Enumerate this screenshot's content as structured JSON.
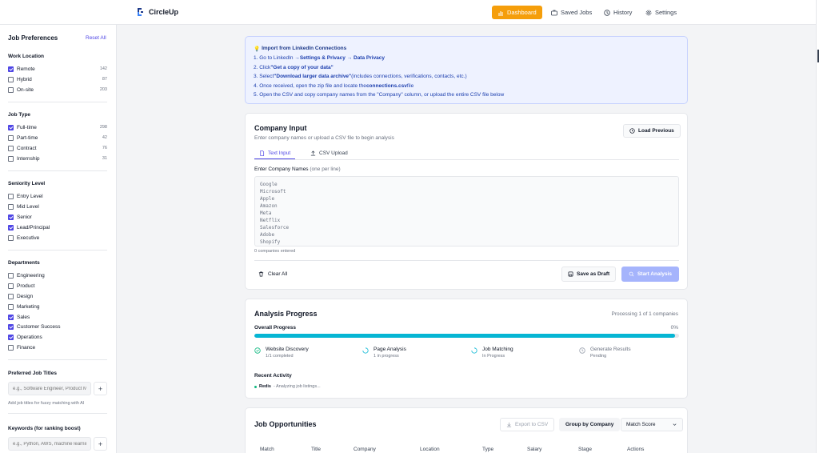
{
  "app": {
    "brand": "CircleUp",
    "nav": [
      {
        "label": "Dashboard",
        "icon": "bar-chart-icon",
        "active": true
      },
      {
        "label": "Saved Jobs",
        "icon": "briefcase-icon",
        "active": false
      },
      {
        "label": "History",
        "icon": "clock-icon",
        "active": false
      },
      {
        "label": "Settings",
        "icon": "gear-icon",
        "active": false
      }
    ]
  },
  "sidebar": {
    "title": "Job Preferences",
    "reset": "Reset All",
    "work_location": {
      "title": "Work Location",
      "items": [
        {
          "label": "Remote",
          "checked": true,
          "count": "142"
        },
        {
          "label": "Hybrid",
          "checked": false,
          "count": "87"
        },
        {
          "label": "On-site",
          "checked": false,
          "count": "203"
        }
      ]
    },
    "job_type": {
      "title": "Job Type",
      "items": [
        {
          "label": "Full-time",
          "checked": true,
          "count": "298"
        },
        {
          "label": "Part-time",
          "checked": false,
          "count": "42"
        },
        {
          "label": "Contract",
          "checked": false,
          "count": "76"
        },
        {
          "label": "Internship",
          "checked": false,
          "count": "31"
        }
      ]
    },
    "seniority": {
      "title": "Seniority Level",
      "items": [
        {
          "label": "Entry Level",
          "checked": false
        },
        {
          "label": "Mid Level",
          "checked": false
        },
        {
          "label": "Senior",
          "checked": true
        },
        {
          "label": "Lead/Principal",
          "checked": true
        },
        {
          "label": "Executive",
          "checked": false
        }
      ]
    },
    "departments": {
      "title": "Departments",
      "items": [
        {
          "label": "Engineering",
          "checked": false
        },
        {
          "label": "Product",
          "checked": false
        },
        {
          "label": "Design",
          "checked": false
        },
        {
          "label": "Marketing",
          "checked": false
        },
        {
          "label": "Sales",
          "checked": true
        },
        {
          "label": "Customer Success",
          "checked": true
        },
        {
          "label": "Operations",
          "checked": true
        },
        {
          "label": "Finance",
          "checked": false
        }
      ]
    },
    "titles": {
      "title": "Preferred Job Titles",
      "placeholder": "e.g., Software Engineer, Product Manager",
      "add": "+",
      "help": "Add job titles for fuzzy matching with AI"
    },
    "keywords": {
      "title": "Keywords (for ranking boost)",
      "placeholder": "e.g., Python, AWS, machine learning",
      "add": "+"
    }
  },
  "import": {
    "title": "Import from LinkedIn Connections",
    "steps": [
      [
        "1. Go to LinkedIn → ",
        "Settings & Privacy → Data Privacy",
        ""
      ],
      [
        "2. Click ",
        "\"Get a copy of your data\"",
        ""
      ],
      [
        "3. Select ",
        "\"Download larger data archive\"",
        " (includes connections, verifications, contacts, etc.)"
      ],
      [
        "4. Once received, open the zip file and locate the ",
        "connections.csv",
        " file"
      ],
      [
        "5. Open the CSV and copy company names from the \"Company\" column, or upload the entire CSV file below",
        "",
        ""
      ]
    ]
  },
  "company_input": {
    "title": "Company Input",
    "subtitle": "Enter company names or upload a CSV file to begin analysis",
    "load_previous": "Load Previous",
    "tabs": [
      "Text Input",
      "CSV Upload"
    ],
    "label": "Enter Company Names",
    "label_hint": "(one per line)",
    "placeholder_lines": [
      "Google",
      "Microsoft",
      "Apple",
      "Amazon",
      "Meta",
      "Netflix",
      "Salesforce",
      "Adobe",
      "Shopify"
    ],
    "count": "0 companies entered",
    "clear": "Clear All",
    "save_draft": "Save as Draft",
    "start": "Start Analysis"
  },
  "progress": {
    "title": "Analysis Progress",
    "status": "Processing 1 of 1 companies",
    "overall_label": "Overall Progress",
    "overall_pct": "0%",
    "overall_value": 0.99,
    "stages": [
      {
        "name": "Website Discovery",
        "sub": "1/1 completed",
        "state": "done"
      },
      {
        "name": "Page Analysis",
        "sub": "1 in progress",
        "state": "active"
      },
      {
        "name": "Job Matching",
        "sub": "In Progress",
        "state": "active"
      },
      {
        "name": "Generate Results",
        "sub": "Pending",
        "state": "pending"
      }
    ],
    "activity_title": "Recent Activity",
    "activity": {
      "company": "Redis",
      "text": "- Analyzing job listings..."
    }
  },
  "jobs": {
    "title": "Job Opportunities",
    "export": "Export to CSV",
    "group": "Group by Company",
    "sort": "Match Score",
    "columns": [
      "Match",
      "Title",
      "Company",
      "Location",
      "Type",
      "Salary",
      "Stage",
      "Actions"
    ]
  },
  "colors": {
    "accent": "#4f46e5",
    "brand_orange": "#f59e0b",
    "progress": "#06b6d4"
  }
}
